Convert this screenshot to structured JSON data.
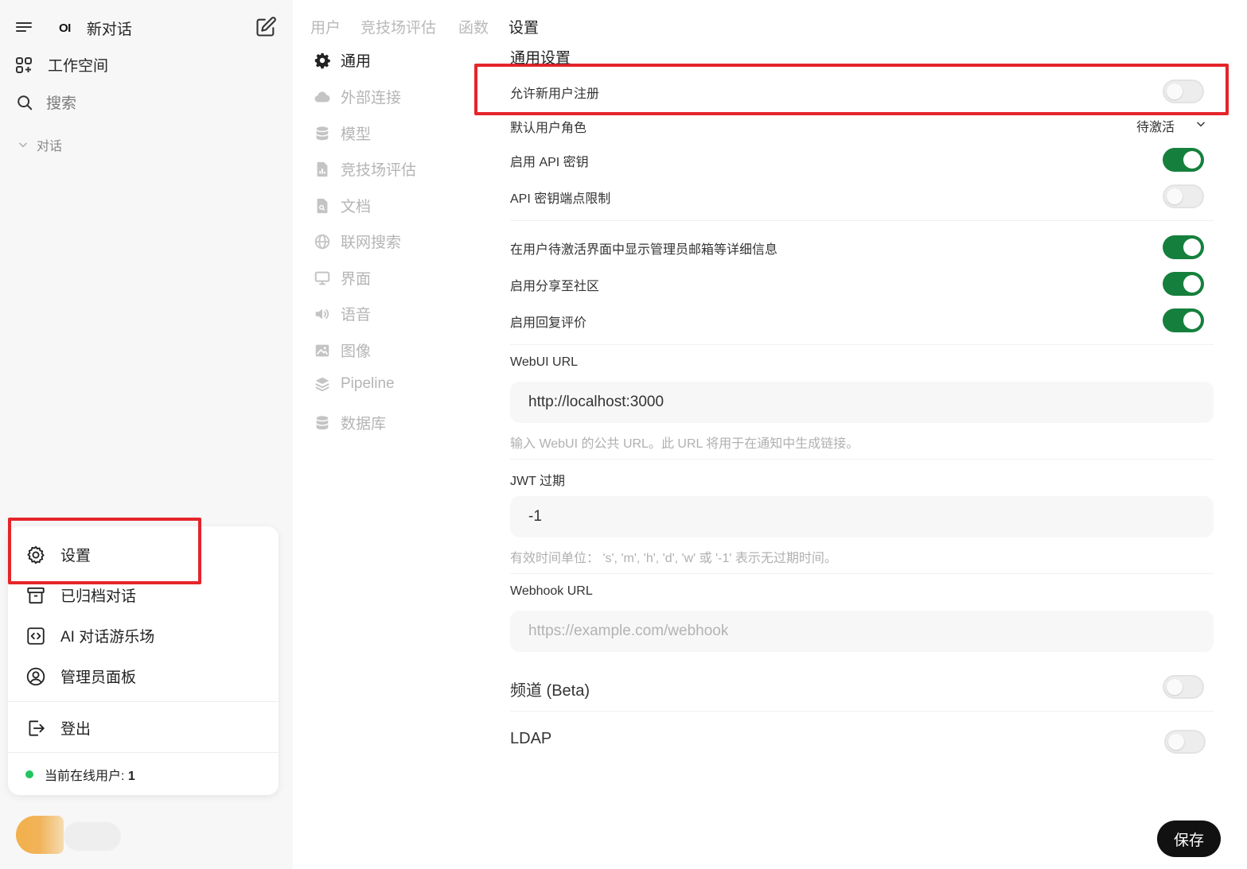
{
  "sidebar": {
    "new_chat_label": "新对话",
    "logo_text": "OI",
    "workspace_label": "工作空间",
    "search_label": "搜索",
    "chats_section_label": "对话",
    "user_menu": {
      "settings_label": "设置",
      "archived_label": "已归档对话",
      "playground_label": "AI 对话游乐场",
      "admin_label": "管理员面板",
      "logout_label": "登出",
      "online_users_label": "当前在线用户:",
      "online_users_count": "1"
    }
  },
  "top_tabs": [
    {
      "label": "用户",
      "active": false
    },
    {
      "label": "竞技场评估",
      "active": false
    },
    {
      "label": "函数",
      "active": false
    },
    {
      "label": "设置",
      "active": true
    }
  ],
  "settings_nav": [
    {
      "label": "通用",
      "icon": "gear-icon",
      "active": true
    },
    {
      "label": "外部连接",
      "icon": "cloud-icon",
      "active": false
    },
    {
      "label": "模型",
      "icon": "database-icon",
      "active": false
    },
    {
      "label": "竞技场评估",
      "icon": "chart-file-icon",
      "active": false
    },
    {
      "label": "文档",
      "icon": "document-icon",
      "active": false
    },
    {
      "label": "联网搜索",
      "icon": "globe-icon",
      "active": false
    },
    {
      "label": "界面",
      "icon": "monitor-icon",
      "active": false
    },
    {
      "label": "语音",
      "icon": "speaker-icon",
      "active": false
    },
    {
      "label": "图像",
      "icon": "image-icon",
      "active": false
    },
    {
      "label": "Pipeline",
      "icon": "layers-icon",
      "active": false
    },
    {
      "label": "数据库",
      "icon": "database-icon",
      "active": false
    }
  ],
  "general": {
    "title": "通用设置",
    "allow_signup": {
      "label": "允许新用户注册",
      "enabled": false
    },
    "default_role": {
      "label": "默认用户角色",
      "value": "待激活"
    },
    "enable_api_key": {
      "label": "启用 API 密钥",
      "enabled": true
    },
    "api_key_endpoint_limit": {
      "label": "API 密钥端点限制",
      "enabled": false
    },
    "show_admin_details": {
      "label": "在用户待激活界面中显示管理员邮箱等详细信息",
      "enabled": true
    },
    "enable_community_sharing": {
      "label": "启用分享至社区",
      "enabled": true
    },
    "enable_message_rating": {
      "label": "启用回复评价",
      "enabled": true
    },
    "webui_url": {
      "label": "WebUI URL",
      "value": "http://localhost:3000",
      "hint": "输入 WebUI 的公共 URL。此 URL 将用于在通知中生成链接。"
    },
    "jwt_expiry": {
      "label": "JWT 过期",
      "value": "-1",
      "hint": "有效时间单位：  's', 'm', 'h', 'd', 'w' 或 '-1' 表示无过期时间。"
    },
    "webhook_url": {
      "label": "Webhook URL",
      "placeholder": "https://example.com/webhook"
    },
    "channels": {
      "label": "频道 (Beta)",
      "enabled": false
    },
    "ldap": {
      "label": "LDAP",
      "enabled": false
    }
  },
  "save_label": "保存",
  "colors": {
    "toggle_on": "#15803d",
    "highlight": "#e5252a",
    "online_dot": "#22c55e"
  }
}
